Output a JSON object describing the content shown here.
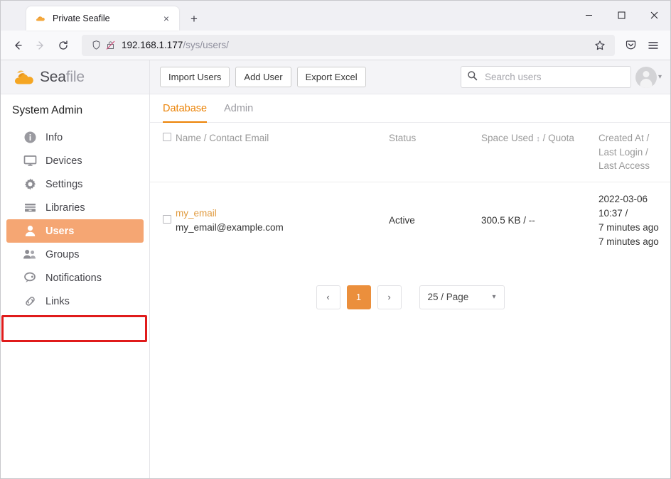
{
  "browser": {
    "tab": {
      "title": "Private Seafile",
      "favicon": "seafile-cloud-icon",
      "close": "×"
    },
    "newtab_label": "+",
    "window_controls": {
      "minimize": "─",
      "maximize": "□",
      "close": "✕"
    },
    "nav": {
      "back": "←",
      "forward": "→",
      "reload": "⟳"
    },
    "url": {
      "host": "192.168.1.177",
      "path": "/sys/users/",
      "shield_icon": "shield-icon",
      "lock_icon": "lock-crossed-icon"
    },
    "toolbar_right": {
      "bookmark": "bookmark-star-icon",
      "pocket": "pocket-icon",
      "menu": "hamburger-menu-icon"
    }
  },
  "app": {
    "brand": {
      "name_bold": "Sea",
      "name_light": "file",
      "logo": "seafile-cloud-logo"
    },
    "actions": [
      {
        "label": "Import Users",
        "name": "import-users-button"
      },
      {
        "label": "Add User",
        "name": "add-user-button"
      },
      {
        "label": "Export Excel",
        "name": "export-excel-button"
      }
    ],
    "search": {
      "placeholder": "Search users",
      "value": "",
      "icon": "search-icon"
    },
    "account": {
      "avatar": "user-avatar",
      "chevron": "▾"
    }
  },
  "sidebar": {
    "title": "System Admin",
    "items": [
      {
        "label": "Info",
        "icon": "info-icon",
        "active": false
      },
      {
        "label": "Devices",
        "icon": "monitor-icon",
        "active": false
      },
      {
        "label": "Settings",
        "icon": "gear-icon",
        "active": false
      },
      {
        "label": "Libraries",
        "icon": "library-icon",
        "active": false
      },
      {
        "label": "Users",
        "icon": "user-icon",
        "active": true
      },
      {
        "label": "Groups",
        "icon": "users-group-icon",
        "active": false
      },
      {
        "label": "Notifications",
        "icon": "speech-bubble-icon",
        "active": false
      },
      {
        "label": "Links",
        "icon": "link-chain-icon",
        "active": false
      }
    ],
    "highlight_color": "#f5a673",
    "annotation_color": "#e01b1b"
  },
  "content": {
    "tabs": [
      {
        "label": "Database",
        "active": true
      },
      {
        "label": "Admin",
        "active": false
      }
    ],
    "table": {
      "headers": {
        "name": "Name / Contact Email",
        "status": "Status",
        "space_prefix": "Space Used",
        "space_sort": "↕",
        "space_suffix": "/ Quota",
        "created_line1": "Created At / Last Login /",
        "created_line2": "Last Access"
      },
      "rows": [
        {
          "name": "my_email",
          "email": "my_email@example.com",
          "status": "Active",
          "space": "300.5 KB / --",
          "created": "2022-03-06 10:37 /",
          "last_login": "7 minutes ago",
          "last_access": "7 minutes ago"
        }
      ]
    },
    "pagination": {
      "prev": "‹",
      "next": "›",
      "current_page": "1",
      "per_page": "25 / Page",
      "chevron": "▾",
      "active_color": "#eb8f3c"
    }
  }
}
